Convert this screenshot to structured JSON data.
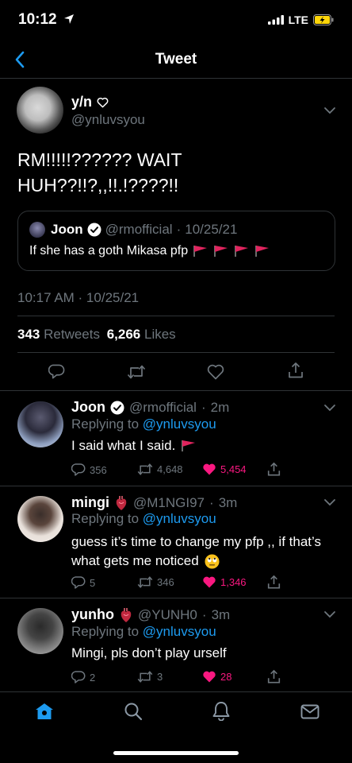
{
  "status_bar": {
    "time": "10:12",
    "network": "LTE"
  },
  "header": {
    "title": "Tweet"
  },
  "main_tweet": {
    "name": "y/n",
    "handle": "@ynluvsyou",
    "text_line1": "RM!!!!!?????? WAIT",
    "text_line2": "HUH??!!?,,!!.!????!!",
    "quote": {
      "name": "Joon",
      "handle": "@rmofficial",
      "date": "10/25/21",
      "text": "If she has a goth Mikasa pfp"
    },
    "timestamp": "10:17 AM · 10/25/21",
    "retweets_count": "343",
    "retweets_label": "Retweets",
    "likes_count": "6,266",
    "likes_label": "Likes"
  },
  "replies": [
    {
      "name": "Joon",
      "handle": "@rmofficial",
      "time": "2m",
      "replying_prefix": "Replying to",
      "replying_to": "@ynluvsyou",
      "text": "I said what I said.",
      "replies": "356",
      "retweets": "4,648",
      "likes": "5,454"
    },
    {
      "name": "mingi",
      "handle": "@M1NGI97",
      "time": "3m",
      "replying_prefix": "Replying to",
      "replying_to": "@ynluvsyou",
      "text_line1": "guess it’s time to change my pfp ,, if that’s",
      "text_line2": "what gets me noticed",
      "replies": "5",
      "retweets": "346",
      "likes": "1,346"
    },
    {
      "name": "yunho",
      "handle": "@YUNH0",
      "time": "3m",
      "replying_prefix": "Replying to",
      "replying_to": "@ynluvsyou",
      "text": "Mingi, pls don’t play urself",
      "replies": "2",
      "retweets": "3",
      "likes": "28"
    }
  ],
  "colors": {
    "link": "#1d9bf0",
    "like": "#f91880",
    "muted": "#6e767d",
    "flag": "#e0245e"
  }
}
